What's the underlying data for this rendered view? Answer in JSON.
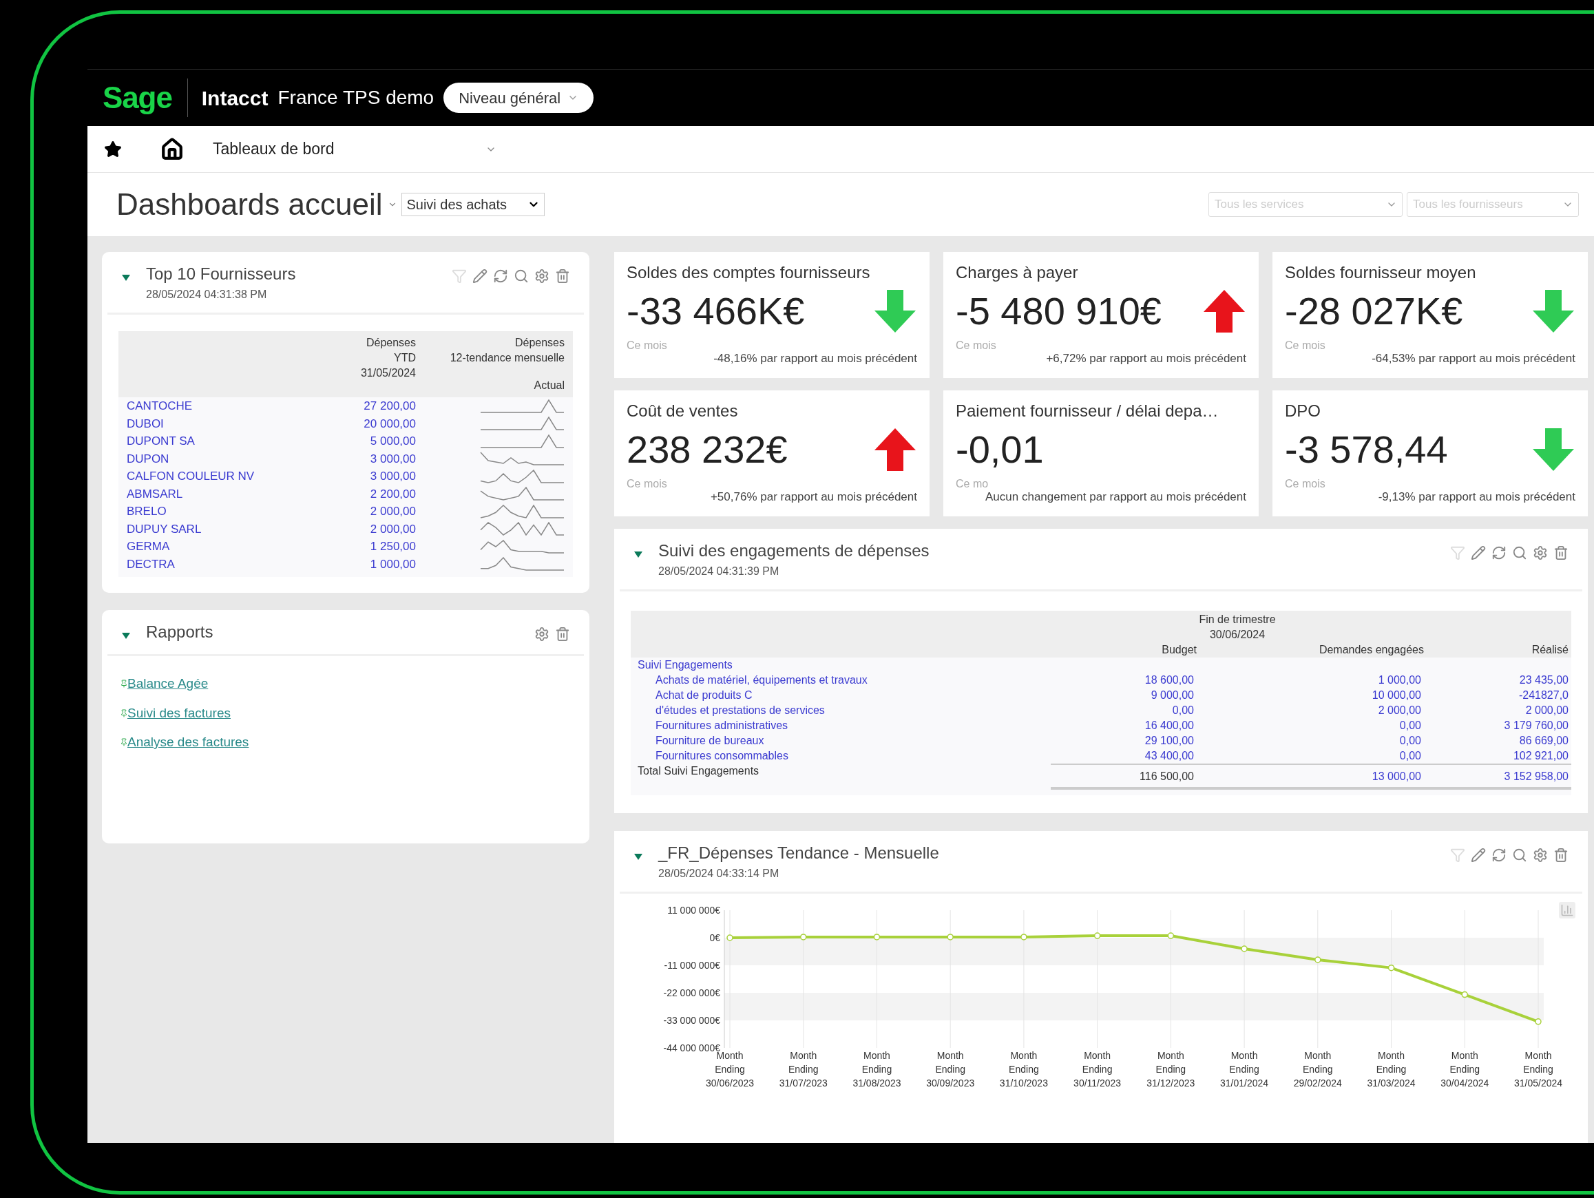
{
  "header": {
    "logo": "Sage",
    "product": "Intacct",
    "company": "France TPS demo",
    "level_selector": "Niveau général"
  },
  "nav": {
    "menu": "Tableaux de bord"
  },
  "page": {
    "title": "Dashboards accueil",
    "dashboard_select": "Suivi des achats",
    "filters": [
      {
        "placeholder": "Tous les services"
      },
      {
        "placeholder": "Tous les fournisseurs"
      }
    ]
  },
  "top_suppliers": {
    "title": "Top 10 Fournisseurs",
    "timestamp": "28/05/2024 04:31:38 PM",
    "expanded": true,
    "filter_active": false,
    "columns": [
      {
        "lines": [
          "Dépenses",
          "YTD",
          "31/05/2024"
        ]
      },
      {
        "lines": [
          "Dépenses",
          "12-tendance mensuelle"
        ],
        "sub": "Actual"
      }
    ],
    "rows": [
      {
        "name": "CANTOCHE",
        "amount": "27 200,00"
      },
      {
        "name": "DUBOI",
        "amount": "20 000,00"
      },
      {
        "name": "DUPONT SA",
        "amount": "5 000,00"
      },
      {
        "name": "DUPON",
        "amount": "3 000,00"
      },
      {
        "name": "CALFON COULEUR NV",
        "amount": "3 000,00"
      },
      {
        "name": "ABMSARL",
        "amount": "2 200,00"
      },
      {
        "name": "BRELO",
        "amount": "2 000,00"
      },
      {
        "name": "DUPUY SARL",
        "amount": "2 000,00"
      },
      {
        "name": "GERMA",
        "amount": "1 250,00"
      },
      {
        "name": "DECTRA",
        "amount": "1 000,00"
      }
    ]
  },
  "reports": {
    "title": "Rapports",
    "expanded": true,
    "links": [
      "Balance Agée",
      "Suivi des factures",
      "Analyse des factures"
    ]
  },
  "kpis": [
    {
      "title": "Soldes des comptes fournisseurs",
      "value": "-33 466K€",
      "arrow_visible": true,
      "rising": false,
      "period": "Ce mois",
      "comparison": "-48,16% par rapport au mois précédent"
    },
    {
      "title": "Charges à payer",
      "value": "-5 480 910€",
      "arrow_visible": true,
      "rising": true,
      "period": "Ce mois",
      "comparison": "+6,72% par rapport au mois précédent"
    },
    {
      "title": "Soldes fournisseur moyen",
      "value": "-28 027K€",
      "arrow_visible": true,
      "rising": false,
      "period": "Ce mois",
      "comparison": "-64,53% par rapport au mois précédent"
    },
    {
      "title": "Coût de ventes",
      "value": "238 232€",
      "arrow_visible": true,
      "rising": true,
      "period": "Ce mois",
      "comparison": "+50,76% par rapport au mois précédent"
    },
    {
      "title": "Paiement fournisseur / délai depa…",
      "value": "-0,01",
      "arrow_visible": false,
      "period": "Ce mo",
      "comparison": "Aucun changement par rapport au mois précédent"
    },
    {
      "title": "DPO",
      "value": "-3 578,44",
      "arrow_visible": true,
      "rising": false,
      "period": "Ce mois",
      "comparison": "-9,13% par rapport au mois précédent"
    }
  ],
  "commitments": {
    "title": "Suivi des engagements de dépenses",
    "timestamp": "28/05/2024 04:31:39 PM",
    "expanded": true,
    "filter_active": false,
    "group_header": [
      "Fin de trimestre",
      "30/06/2024"
    ],
    "columns": [
      "Budget",
      "Demandes engagées",
      "Réalisé"
    ],
    "group": "Suivi Engagements",
    "rows": [
      {
        "label": "Achats de matériel, équipements et travaux",
        "values": [
          "18 600,00",
          "1 000,00",
          "23 435,00"
        ]
      },
      {
        "label": "Achat de produits C",
        "values": [
          "9 000,00",
          "10 000,00",
          "-241827,0"
        ]
      },
      {
        "label": "d'études et prestations de services",
        "values": [
          "0,00",
          "2 000,00",
          "2 000,00"
        ]
      },
      {
        "label": "Fournitures administratives",
        "values": [
          "16 400,00",
          "0,00",
          "3 179 760,00"
        ]
      },
      {
        "label": "Fourniture de bureaux",
        "values": [
          "29 100,00",
          "0,00",
          "86 669,00"
        ]
      },
      {
        "label": "Fournitures consommables",
        "values": [
          "43 400,00",
          "0,00",
          "102 921,00"
        ]
      }
    ],
    "total": {
      "label": "Total Suivi Engagements",
      "values": [
        "116 500,00",
        "13 000,00",
        "3 152 958,00"
      ]
    }
  },
  "trend": {
    "title": "_FR_Dépenses Tendance - Mensuelle",
    "timestamp": "28/05/2024 04:33:14 PM",
    "expanded": true,
    "filter_active": false,
    "chart_data": {
      "type": "line",
      "categories": [
        "Month Ending 30/06/2023",
        "Month Ending 31/07/2023",
        "Month Ending 31/08/2023",
        "Month Ending 30/09/2023",
        "Month Ending 31/10/2023",
        "Month Ending 30/11/2023",
        "Month Ending 31/12/2023",
        "Month Ending 31/01/2024",
        "Month Ending 29/02/2024",
        "Month Ending 31/03/2024",
        "Month Ending 30/04/2024",
        "Month Ending 31/05/2024"
      ],
      "series": [
        {
          "color": "#a8d13a",
          "marker": true,
          "values": [
            0,
            300000,
            300000,
            300000,
            300000,
            800000,
            800000,
            -4400000,
            -8800000,
            -12000000,
            -22700000,
            -33500000
          ]
        }
      ],
      "grid": true,
      "ylim": [
        -44000000,
        11000000
      ],
      "yticks": [
        {
          "value": 11000000,
          "label": "11 000 000€"
        },
        {
          "value": 0,
          "label": "0€"
        },
        {
          "value": -11000000,
          "label": "-11 000 000€"
        },
        {
          "value": -22000000,
          "label": "-22 000 000€"
        },
        {
          "value": -33000000,
          "label": "-33 000 000€"
        },
        {
          "value": -44000000,
          "label": "-44 000 000€"
        }
      ]
    }
  }
}
